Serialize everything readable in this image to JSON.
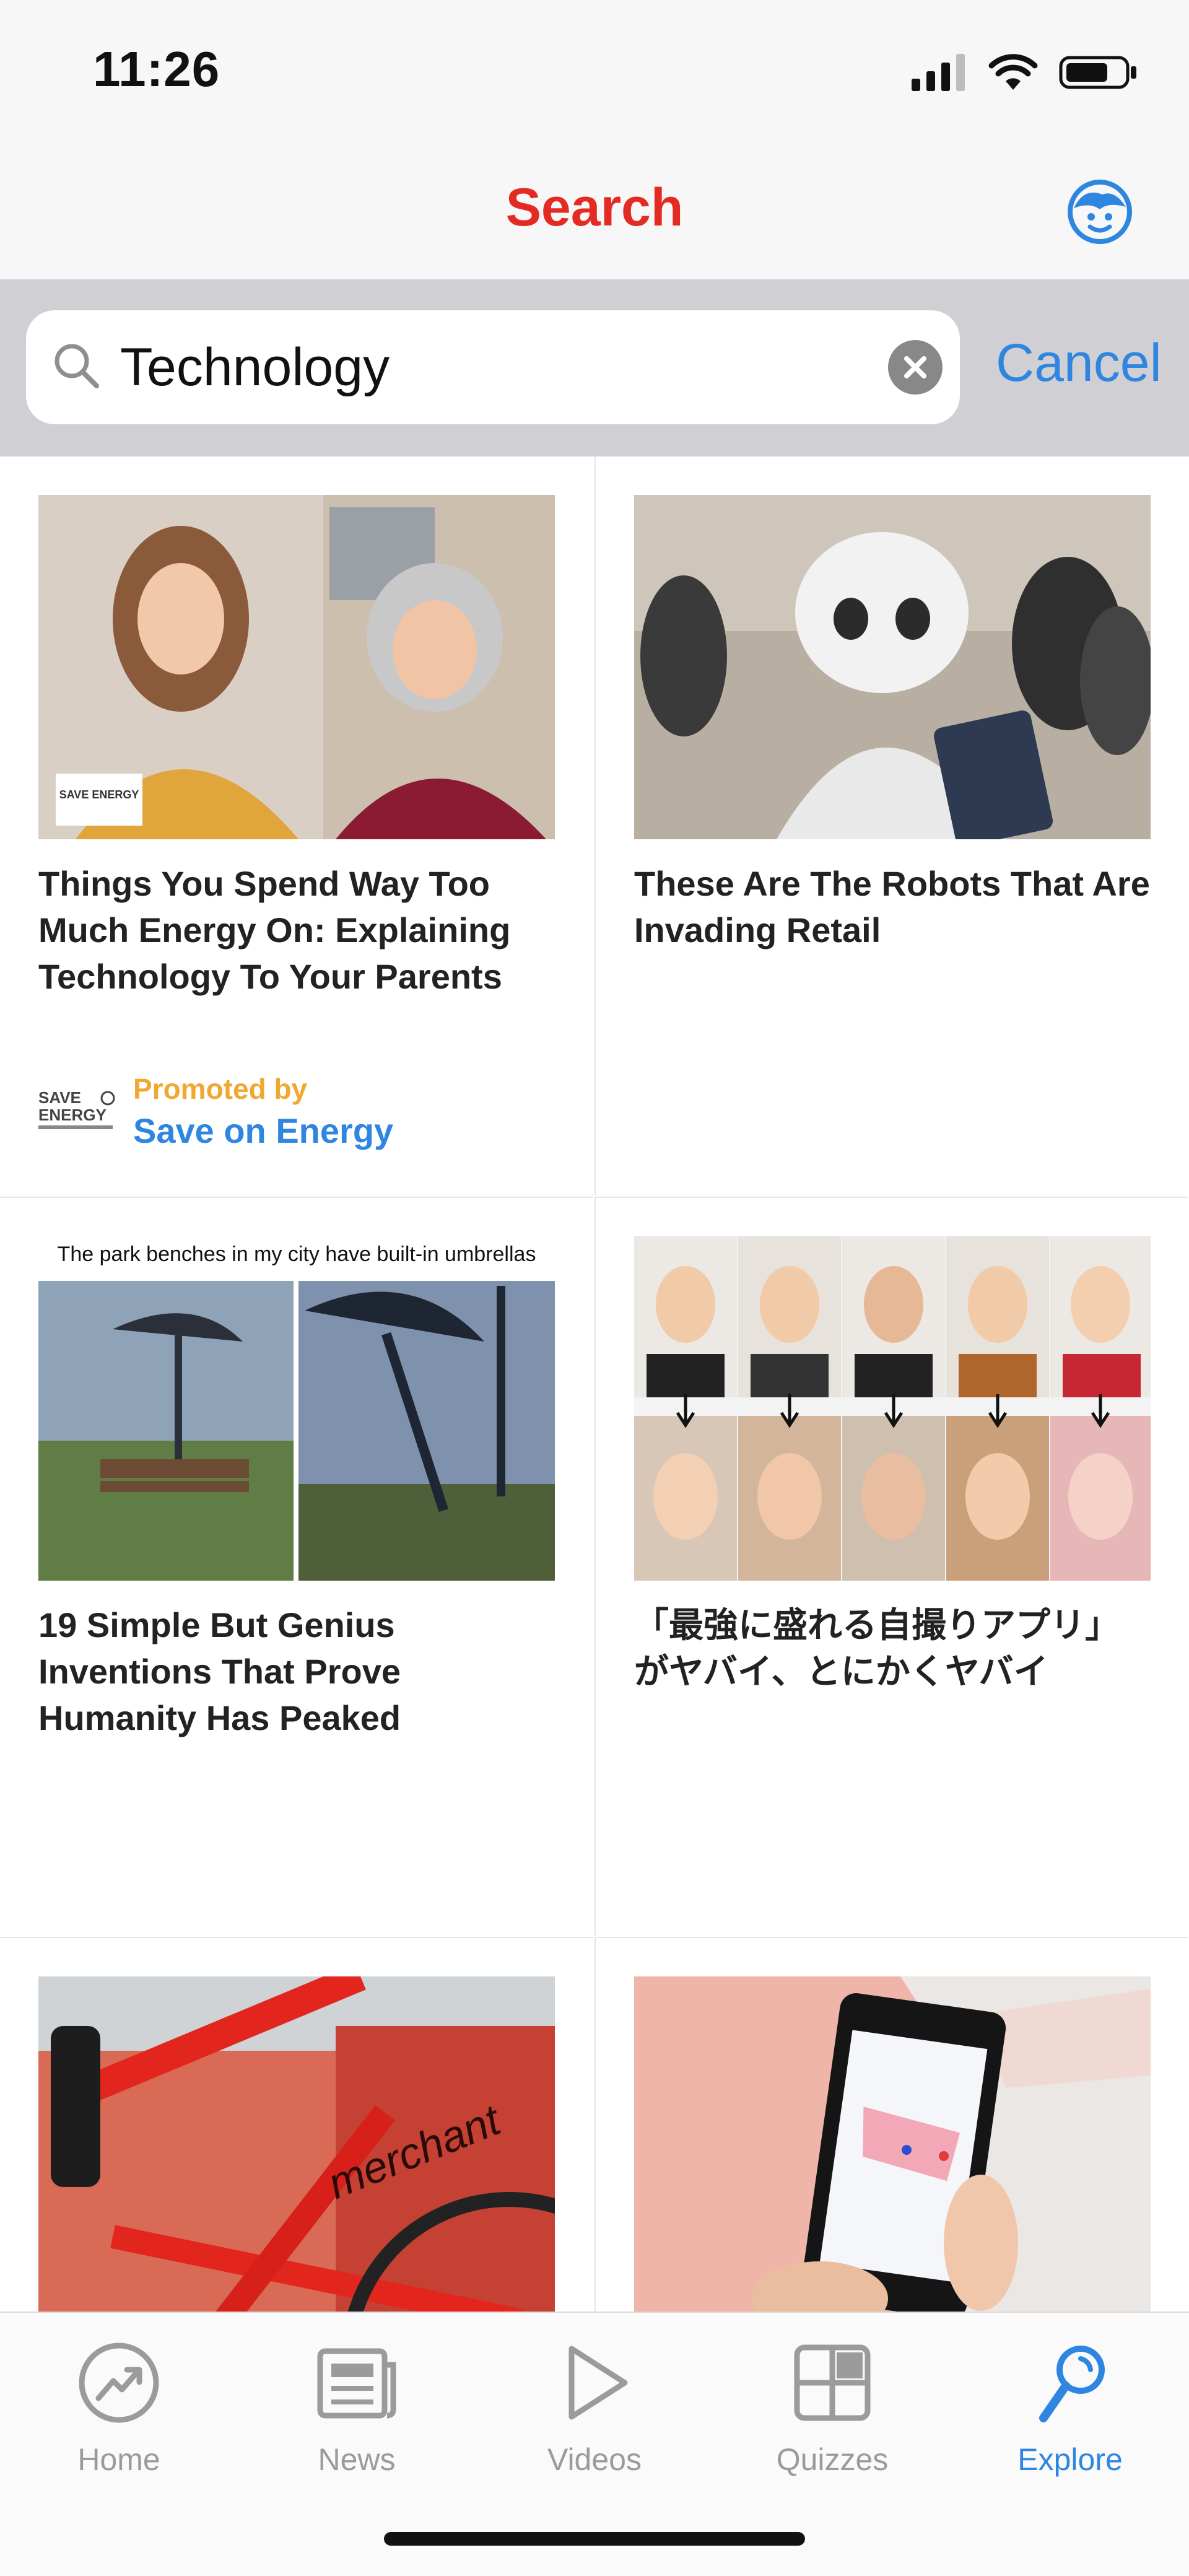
{
  "status_bar": {
    "time": "11:26"
  },
  "nav": {
    "title": "Search"
  },
  "search": {
    "value": "Technology",
    "placeholder": "Search",
    "cancel_label": "Cancel"
  },
  "cards": [
    {
      "title": "Things You Spend Way Too Much Energy On: Explaining Technology To Your Parents",
      "promo_label": "Promoted by",
      "promo_name": "Save on Energy",
      "thumb_logo_text": "SAVE ENERGY"
    },
    {
      "title": "These Are The Robots That Are Invading Retail"
    },
    {
      "title": "19 Simple But Genius Inventions That Prove Humanity Has Peaked",
      "thumb_caption": "The park benches in my city have built-in umbrellas"
    },
    {
      "title": "「最強に盛れる自撮りアプリ」がヤバイ、とにかくヤバイ"
    },
    {
      "title": "",
      "thumb_text": "merchant"
    },
    {
      "title": ""
    }
  ],
  "tabs": [
    {
      "label": "Home",
      "icon": "trending-icon"
    },
    {
      "label": "News",
      "icon": "newspaper-icon"
    },
    {
      "label": "Videos",
      "icon": "play-icon"
    },
    {
      "label": "Quizzes",
      "icon": "grid-icon"
    },
    {
      "label": "Explore",
      "icon": "explore-icon",
      "active": true
    }
  ],
  "colors": {
    "accent": "#2f86e0",
    "brand": "#e32b24",
    "promo": "#f0a830"
  }
}
